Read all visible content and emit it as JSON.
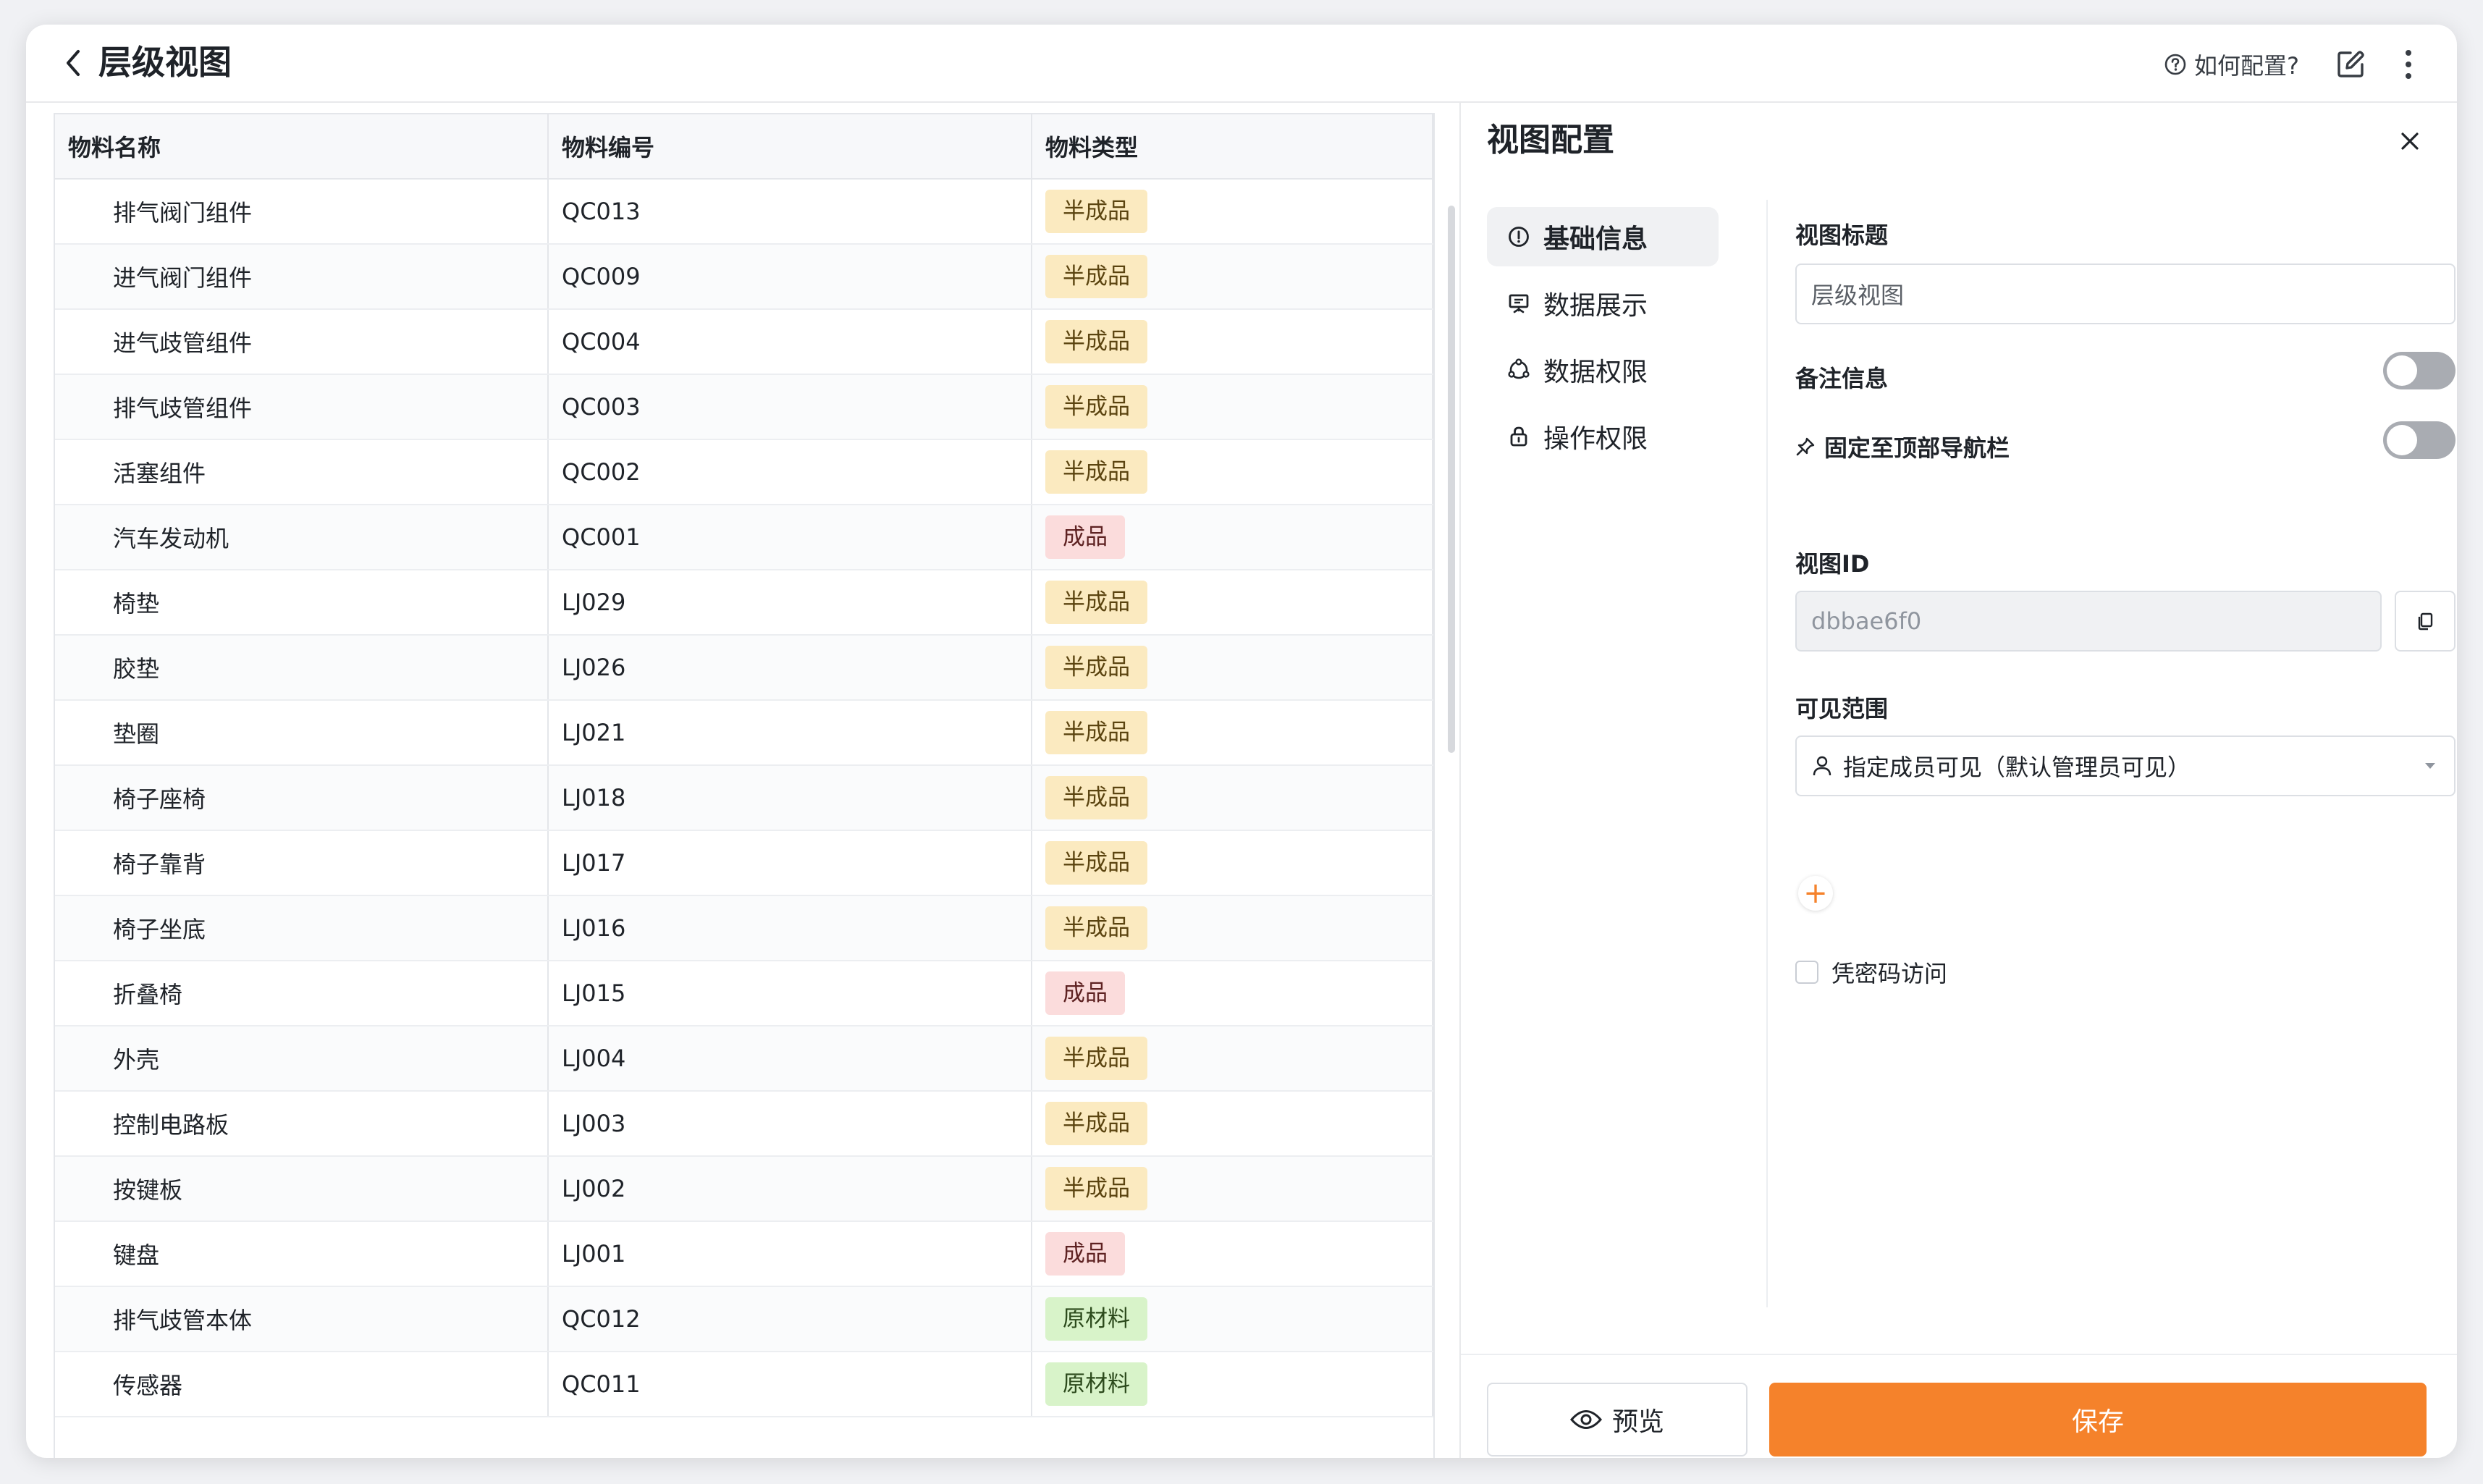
{
  "header": {
    "title": "层级视图",
    "help_label": "如何配置?"
  },
  "table": {
    "columns": [
      "物料名称",
      "物料编号",
      "物料类型"
    ],
    "rows": [
      {
        "name": "排气阀门组件",
        "code": "QC013",
        "type": "半成品"
      },
      {
        "name": "进气阀门组件",
        "code": "QC009",
        "type": "半成品"
      },
      {
        "name": "进气歧管组件",
        "code": "QC004",
        "type": "半成品"
      },
      {
        "name": "排气歧管组件",
        "code": "QC003",
        "type": "半成品"
      },
      {
        "name": "活塞组件",
        "code": "QC002",
        "type": "半成品"
      },
      {
        "name": "汽车发动机",
        "code": "QC001",
        "type": "成品"
      },
      {
        "name": "椅垫",
        "code": "LJ029",
        "type": "半成品"
      },
      {
        "name": "胶垫",
        "code": "LJ026",
        "type": "半成品"
      },
      {
        "name": "垫圈",
        "code": "LJ021",
        "type": "半成品"
      },
      {
        "name": "椅子座椅",
        "code": "LJ018",
        "type": "半成品"
      },
      {
        "name": "椅子靠背",
        "code": "LJ017",
        "type": "半成品"
      },
      {
        "name": "椅子坐底",
        "code": "LJ016",
        "type": "半成品"
      },
      {
        "name": "折叠椅",
        "code": "LJ015",
        "type": "成品"
      },
      {
        "name": "外壳",
        "code": "LJ004",
        "type": "半成品"
      },
      {
        "name": "控制电路板",
        "code": "LJ003",
        "type": "半成品"
      },
      {
        "name": "按键板",
        "code": "LJ002",
        "type": "半成品"
      },
      {
        "name": "键盘",
        "code": "LJ001",
        "type": "成品"
      },
      {
        "name": "排气歧管本体",
        "code": "QC012",
        "type": "原材料"
      },
      {
        "name": "传感器",
        "code": "QC011",
        "type": "原材料"
      }
    ],
    "tag_colors": {
      "半成品": {
        "bg": "#fbeac0",
        "fg": "#5b4410"
      },
      "成品": {
        "bg": "#fbdcdc",
        "fg": "#5e2222"
      },
      "原材料": {
        "bg": "#d8f3c9",
        "fg": "#2c4a1c"
      }
    }
  },
  "panel": {
    "title": "视图配置",
    "nav": [
      {
        "label": "基础信息",
        "icon": "info-icon",
        "active": true
      },
      {
        "label": "数据展示",
        "icon": "display-icon",
        "active": false
      },
      {
        "label": "数据权限",
        "icon": "data-permission-icon",
        "active": false
      },
      {
        "label": "操作权限",
        "icon": "lock-icon",
        "active": false
      }
    ],
    "form": {
      "view_title_label": "视图标题",
      "view_title_value": "层级视图",
      "remark_label": "备注信息",
      "remark_enabled": false,
      "pin_label": "固定至顶部导航栏",
      "pin_enabled": false,
      "view_id_label": "视图ID",
      "view_id_value": "dbbae6f0",
      "visibility_label": "可见范围",
      "visibility_value": "指定成员可见（默认管理员可见）",
      "add_symbol": "+",
      "password_label": "凭密码访问",
      "password_checked": false
    },
    "preview_label": "预览",
    "save_label": "保存"
  },
  "colors": {
    "accent": "#f5822b",
    "accent_light": "#fbd5b6"
  }
}
